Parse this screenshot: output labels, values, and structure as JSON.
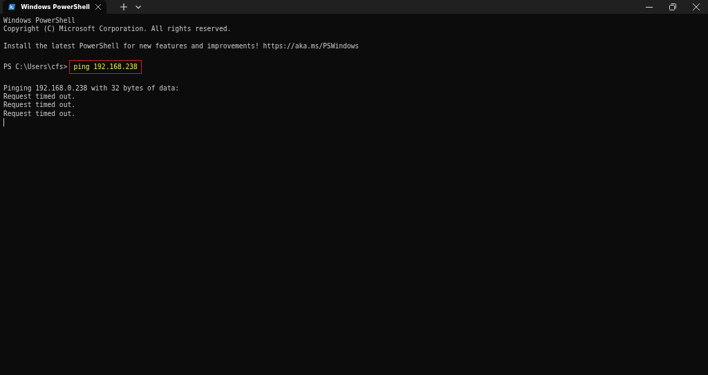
{
  "tabs": [
    {
      "title": "Windows PowerShell",
      "selected": true
    }
  ],
  "terminal": {
    "lines": [
      {
        "kind": "text",
        "text": "Windows PowerShell"
      },
      {
        "kind": "text",
        "text": "Copyright (C) Microsoft Corporation. All rights reserved."
      },
      {
        "kind": "blank"
      },
      {
        "kind": "text",
        "text": "Install the latest PowerShell for new features and improvements! https://aka.ms/PSWindows"
      },
      {
        "kind": "blank"
      },
      {
        "kind": "prompt",
        "prompt": "PS C:\\Users\\cfs>",
        "command": "ping 192.168.238",
        "highlighted": true
      },
      {
        "kind": "blank"
      },
      {
        "kind": "text",
        "text": "Pinging 192.168.0.238 with 32 bytes of data:"
      },
      {
        "kind": "text",
        "text": "Request timed out."
      },
      {
        "kind": "text",
        "text": "Request timed out."
      },
      {
        "kind": "text",
        "text": "Request timed out."
      },
      {
        "kind": "cursor"
      }
    ]
  }
}
